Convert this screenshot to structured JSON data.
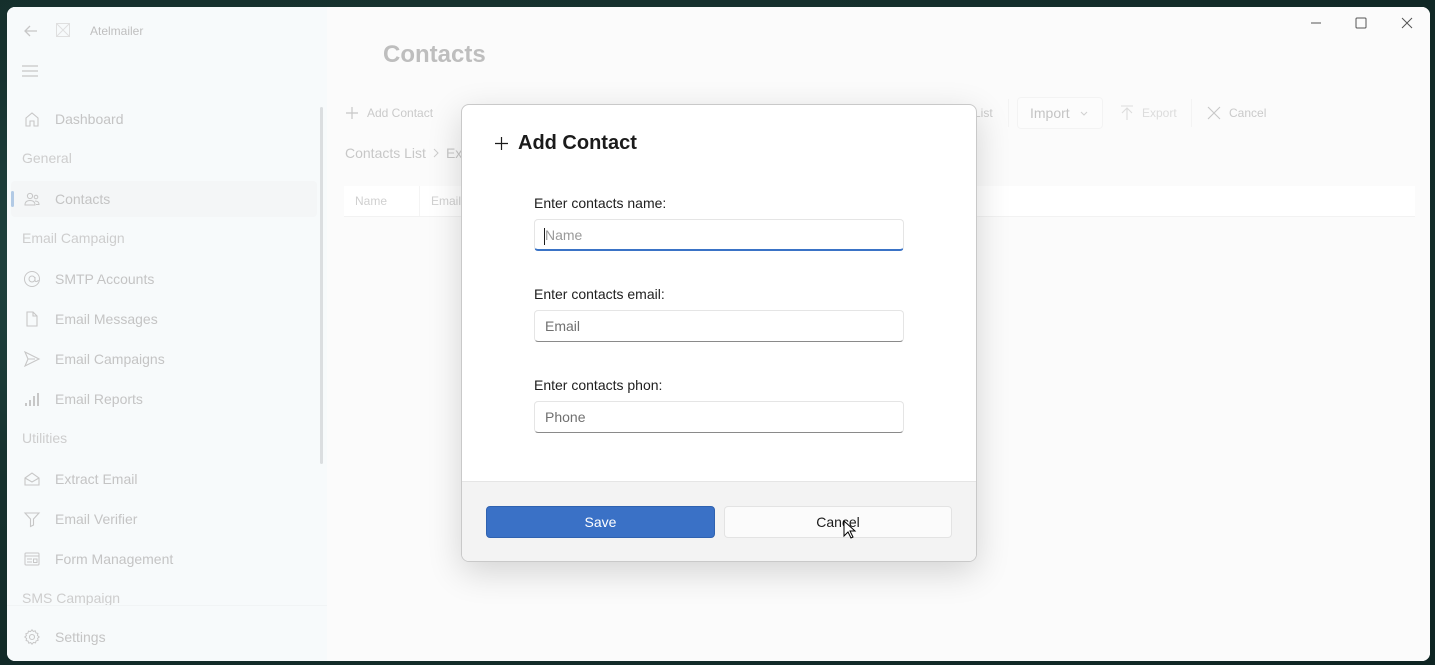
{
  "app": {
    "title": "Atelmailer"
  },
  "sidebar": {
    "items": [
      {
        "type": "item",
        "label": "Dashboard",
        "icon": "home-icon"
      },
      {
        "type": "header",
        "label": "General"
      },
      {
        "type": "item",
        "label": "Contacts",
        "icon": "people-icon",
        "active": true
      },
      {
        "type": "header",
        "label": "Email Campaign"
      },
      {
        "type": "item",
        "label": "SMTP Accounts",
        "icon": "at-sign-icon"
      },
      {
        "type": "item",
        "label": "Email Messages",
        "icon": "document-icon"
      },
      {
        "type": "item",
        "label": "Email Campaigns",
        "icon": "send-icon"
      },
      {
        "type": "item",
        "label": "Email Reports",
        "icon": "bar-chart-icon"
      },
      {
        "type": "header",
        "label": "Utilities"
      },
      {
        "type": "item",
        "label": "Extract Email",
        "icon": "open-envelope-icon"
      },
      {
        "type": "item",
        "label": "Email Verifier",
        "icon": "filter-icon"
      },
      {
        "type": "item",
        "label": "Form Management",
        "icon": "form-icon"
      },
      {
        "type": "header",
        "label": "SMS Campaign"
      }
    ],
    "footer": {
      "label": "Settings",
      "icon": "gear-icon"
    }
  },
  "main": {
    "page_title": "Contacts",
    "toolbar": {
      "add_contact": "Add Contact",
      "list_partial": "List",
      "import": "Import",
      "export": "Export",
      "cancel": "Cancel"
    },
    "breadcrumb": [
      "Contacts List",
      "Exa"
    ],
    "grid_columns": [
      "Name",
      "Email"
    ]
  },
  "dialog": {
    "title": "Add Contact",
    "fields": [
      {
        "label": "Enter contacts name:",
        "placeholder": "Name",
        "value": "",
        "focused": true
      },
      {
        "label": "Enter contacts email:",
        "placeholder": "Email",
        "value": ""
      },
      {
        "label": "Enter contacts phon:",
        "placeholder": "Phone",
        "value": ""
      }
    ],
    "save_label": "Save",
    "cancel_label": "Cancel"
  },
  "colors": {
    "accent": "#3a71c6",
    "focus_underline": "#3a73c6"
  }
}
